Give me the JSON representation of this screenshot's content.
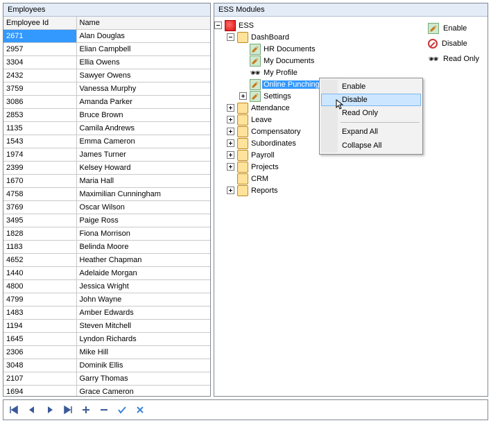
{
  "panels": {
    "employees_title": "Employees",
    "modules_title": "ESS Modules"
  },
  "employees": {
    "columns": {
      "id": "Employee Id",
      "name": "Name"
    },
    "rows": [
      {
        "id": "2671",
        "name": "Alan Douglas"
      },
      {
        "id": "2957",
        "name": "Elian Campbell"
      },
      {
        "id": "3304",
        "name": "Ellia Owens"
      },
      {
        "id": "2432",
        "name": "Sawyer Owens"
      },
      {
        "id": "3759",
        "name": "Vanessa Murphy"
      },
      {
        "id": "3086",
        "name": "Amanda Parker"
      },
      {
        "id": "2853",
        "name": "Bruce Brown"
      },
      {
        "id": "1135",
        "name": "Camila Andrews"
      },
      {
        "id": "1543",
        "name": "Emma Cameron"
      },
      {
        "id": "1974",
        "name": "James Turner"
      },
      {
        "id": "2399",
        "name": "Kelsey Howard"
      },
      {
        "id": "1670",
        "name": "Maria Hall"
      },
      {
        "id": "4758",
        "name": "Maximilian Cunningham"
      },
      {
        "id": "3769",
        "name": "Oscar Wilson"
      },
      {
        "id": "3495",
        "name": "Paige Ross"
      },
      {
        "id": "1828",
        "name": "Fiona Morrison"
      },
      {
        "id": "1183",
        "name": "Belinda Moore"
      },
      {
        "id": "4652",
        "name": "Heather Chapman"
      },
      {
        "id": "1440",
        "name": "Adelaide Morgan"
      },
      {
        "id": "4800",
        "name": "Jessica Wright"
      },
      {
        "id": "4799",
        "name": "John Wayne"
      },
      {
        "id": "1483",
        "name": "Amber Edwards"
      },
      {
        "id": "1194",
        "name": "Steven Mitchell"
      },
      {
        "id": "1645",
        "name": "Lyndon Richards"
      },
      {
        "id": "2306",
        "name": "Mike Hill"
      },
      {
        "id": "3048",
        "name": "Dominik Ellis"
      },
      {
        "id": "2107",
        "name": "Garry Thomas"
      },
      {
        "id": "1694",
        "name": "Grace Cameron"
      }
    ],
    "selected_index": 0
  },
  "tree": {
    "root_label": "ESS",
    "dashboard_label": "DashBoard",
    "dashboard_children": [
      {
        "label": "HR Documents",
        "status": "enable",
        "expandable": false
      },
      {
        "label": "My Documents",
        "status": "enable",
        "expandable": false
      },
      {
        "label": "My Profile",
        "status": "readonly",
        "expandable": false
      },
      {
        "label": "Online Punching",
        "status": "enable",
        "expandable": false,
        "selected": true
      },
      {
        "label": "Settings",
        "status": "enable",
        "expandable": true
      }
    ],
    "root_children": [
      {
        "label": "Attendance",
        "expandable": true
      },
      {
        "label": "Leave",
        "expandable": true
      },
      {
        "label": "Compensatory",
        "expandable": true,
        "truncated": true
      },
      {
        "label": "Subordinates",
        "expandable": true
      },
      {
        "label": "Payroll",
        "expandable": true
      },
      {
        "label": "Projects",
        "expandable": true
      },
      {
        "label": "CRM",
        "expandable": false
      },
      {
        "label": "Reports",
        "expandable": true
      }
    ]
  },
  "legend": {
    "enable": "Enable",
    "disable": "Disable",
    "readonly": "Read Only"
  },
  "context_menu": {
    "items": [
      {
        "label": "Enable"
      },
      {
        "label": "Disable",
        "highlight": true
      },
      {
        "label": "Read Only"
      }
    ],
    "items2": [
      {
        "label": "Expand All"
      },
      {
        "label": "Collapse All"
      }
    ]
  },
  "toolbar": {
    "first": "First",
    "prev": "Previous",
    "next": "Next",
    "last": "Last",
    "add": "Add",
    "remove": "Remove",
    "ok": "Apply",
    "cancel": "Cancel"
  }
}
